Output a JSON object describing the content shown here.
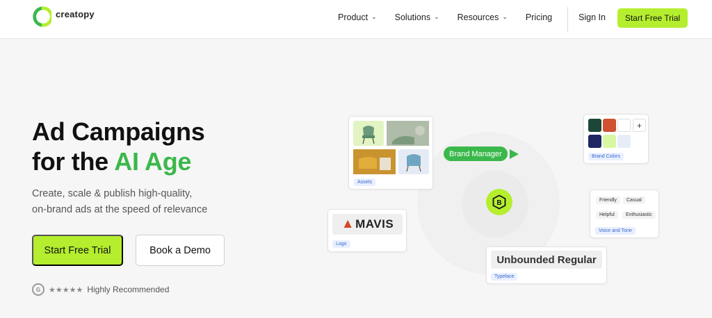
{
  "header": {
    "logo_text": "creatopy",
    "nav": [
      {
        "label": "Product",
        "has_dropdown": true
      },
      {
        "label": "Solutions",
        "has_dropdown": true
      },
      {
        "label": "Resources",
        "has_dropdown": true
      },
      {
        "label": "Pricing",
        "has_dropdown": false
      }
    ],
    "signin_label": "Sign In",
    "cta_label": "Start Free Trial"
  },
  "hero": {
    "title_line1": "Ad Campaigns",
    "title_line2_prefix": "for the ",
    "title_line2_accent": "AI Age",
    "subtitle_line1": "Create, scale & publish high-quality,",
    "subtitle_line2": "on-brand ads at the speed of relevance",
    "primary_button": "Start Free Trial",
    "secondary_button": "Book a Demo",
    "rating_label": "Highly Recommended",
    "rating_stars": "★★★★★",
    "rating_value": 4.5
  },
  "illustration": {
    "assets_tag": "Assets",
    "brand_manager_label": "Brand Manager",
    "brand_badge_letter": "B",
    "brand_colors_tag": "Brand Colors",
    "swatch_colors": [
      "#1d4636",
      "#d0502f",
      "#ffffff",
      "#1d2563",
      "#d8f7a3",
      "#e6edf9"
    ],
    "add_swatch": "+",
    "logo_text": "MAVIS",
    "logo_tag": "Logo",
    "voice_chips": [
      "Friendly",
      "Casual",
      "Helpful",
      "Enthusiastic"
    ],
    "voice_tag": "Voice and Tone",
    "typeface_name": "Unbounded Regular",
    "typeface_tag": "Typeface"
  },
  "colors": {
    "accent_green": "#b4ee2e",
    "brand_green": "#3bb84b",
    "tag_blue": "#3865c9"
  }
}
